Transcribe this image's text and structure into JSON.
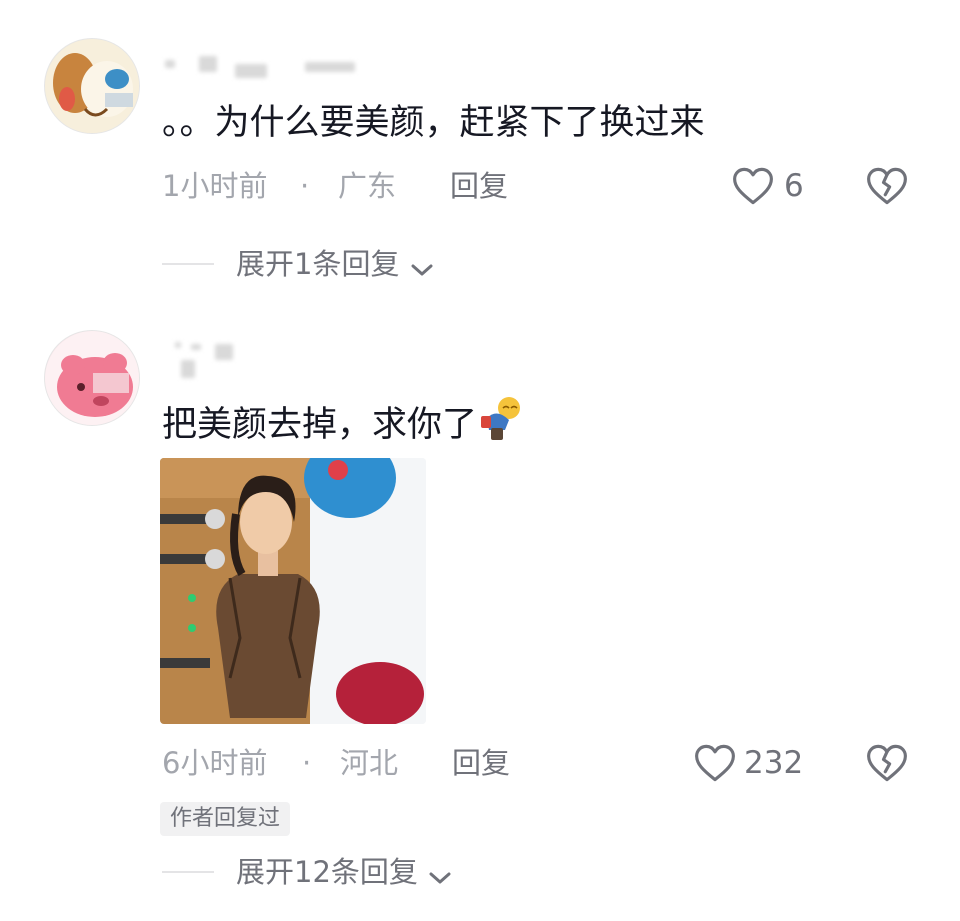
{
  "comments": [
    {
      "text": "。。为什么要美颜，赶紧下了换过来",
      "time": "1小时前",
      "sep": "·",
      "location": "广东",
      "reply_label": "回复",
      "like_count": "6",
      "expand_label": "展开1条回复",
      "avatar_icon": "cartoon-dog-avatar"
    },
    {
      "text": "把美颜去掉，求你了",
      "emoji": "bowing-person-emoji",
      "time": "6小时前",
      "sep": "·",
      "location": "河北",
      "reply_label": "回复",
      "like_count": "232",
      "author_badge": "作者回复过",
      "expand_label": "展开12条回复",
      "avatar_icon": "pink-cartoon-avatar"
    }
  ],
  "colors": {
    "text_primary": "#161823",
    "text_secondary": "#a3a6ad",
    "text_action": "#70727a"
  }
}
